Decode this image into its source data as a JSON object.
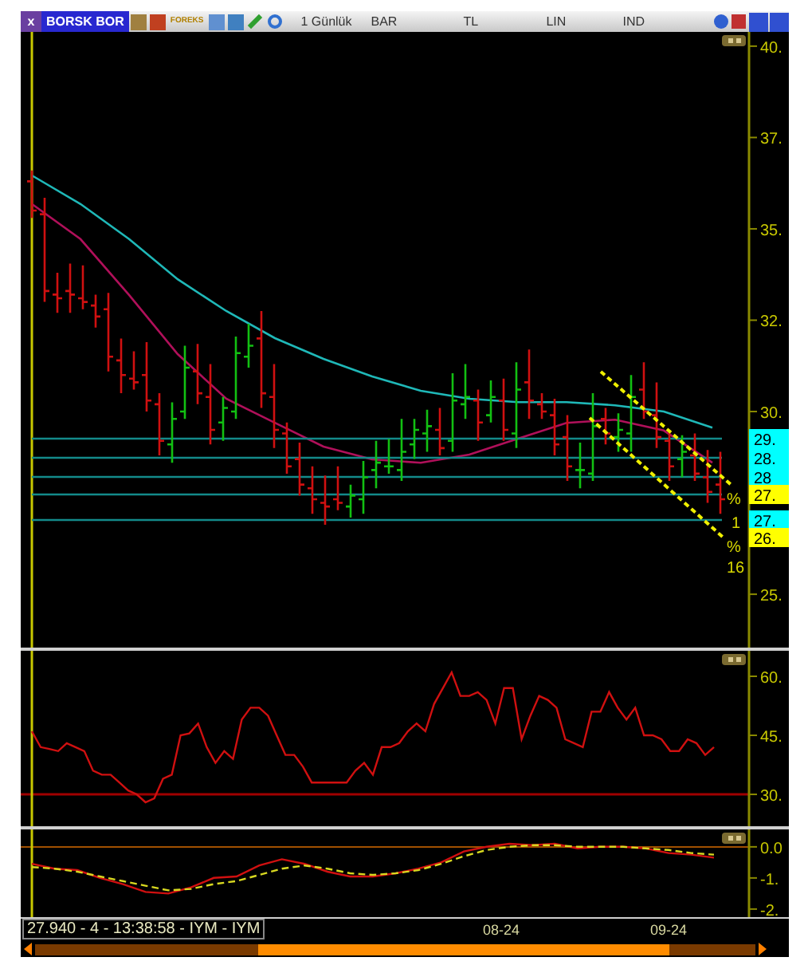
{
  "title_bar": {
    "close_glyph": "x",
    "symbol": "BORSK BOR",
    "logo_text": "FOREKS",
    "menus": [
      "1 Günlük",
      "BAR",
      "TL",
      "LIN",
      "IND"
    ]
  },
  "price_panel": {
    "chart_data": {
      "type": "line",
      "ylim": [
        23.54,
        40.39
      ],
      "yticks": [
        {
          "value": 40,
          "label": "40."
        },
        {
          "value": 37.5,
          "label": "37."
        },
        {
          "value": 35,
          "label": "35."
        },
        {
          "value": 32.5,
          "label": "32."
        },
        {
          "value": 30,
          "label": "30."
        },
        {
          "value": 25,
          "label": "25."
        }
      ],
      "series": [
        {
          "color": "#1fb8b8",
          "values": [
            36.46,
            35.68,
            34.72,
            33.62,
            32.75,
            32.01,
            31.44,
            30.96,
            30.57,
            30.35,
            30.26,
            30.26,
            30.17,
            30.0,
            29.56
          ]
        },
        {
          "color": "#b0105a",
          "values": [
            35.68,
            34.72,
            33.19,
            31.57,
            30.35,
            29.69,
            29.04,
            28.69,
            28.6,
            28.82,
            29.26,
            29.69,
            29.78,
            29.48,
            28.6
          ]
        }
      ]
    },
    "price_tags": [
      {
        "label": "29.",
        "color": "#00ffff"
      },
      {
        "label": "28.",
        "color": "#00ffff"
      },
      {
        "label": "28",
        "color": "#00ffff"
      },
      {
        "label": "27.",
        "color": "#ffff00"
      },
      {
        "label": "27.",
        "color": "#00ffff"
      },
      {
        "label": "26.",
        "color": "#ffff00"
      }
    ],
    "axis_notes": [
      "%",
      "1",
      "%",
      "16"
    ]
  },
  "rsi_panel": {
    "chart_data": {
      "type": "line",
      "ylim": [
        21.9,
        66.49
      ],
      "yticks": [
        {
          "value": 60,
          "label": "60."
        },
        {
          "value": 45,
          "label": "45."
        },
        {
          "value": 30,
          "label": "30."
        }
      ],
      "series": [
        {
          "color": "#d01010",
          "values": [
            46,
            42,
            41.5,
            41,
            43,
            42,
            41,
            36,
            35,
            35,
            33,
            31,
            30,
            28,
            29,
            34,
            35,
            45,
            45.5,
            48,
            42,
            38,
            41,
            39,
            49,
            52,
            52,
            50,
            45,
            40,
            40,
            37,
            33,
            33,
            33,
            33,
            33,
            36,
            38,
            35,
            42,
            42,
            43,
            46,
            48,
            46,
            53,
            57,
            61,
            55,
            55,
            56,
            54,
            48,
            57,
            57,
            44,
            50,
            55,
            54,
            52,
            44,
            43,
            42,
            51,
            51,
            56,
            52,
            49,
            52,
            45,
            45,
            44,
            41,
            41,
            44,
            43,
            40,
            42
          ]
        }
      ]
    }
  },
  "macd_panel": {
    "chart_data": {
      "type": "line",
      "ylim": [
        -2.26,
        0.56
      ],
      "yticks": [
        {
          "value": 0,
          "label": "0.0"
        },
        {
          "value": -1,
          "label": "-1."
        },
        {
          "value": -2,
          "label": "-2."
        }
      ],
      "series": [
        {
          "color": "#d01010",
          "line_style": "solid",
          "values": [
            -0.55,
            -0.7,
            -0.75,
            -1.0,
            -1.2,
            -1.45,
            -1.5,
            -1.3,
            -1.0,
            -0.95,
            -0.6,
            -0.4,
            -0.55,
            -0.8,
            -0.95,
            -0.95,
            -0.85,
            -0.7,
            -0.5,
            -0.15,
            0.0,
            0.1,
            0.05,
            0.1,
            -0.05,
            0.0,
            0.0,
            -0.05,
            -0.2,
            -0.25,
            -0.35
          ]
        },
        {
          "color": "#d8d820",
          "line_style": "dashed",
          "values": [
            -0.65,
            -0.7,
            -0.8,
            -0.95,
            -1.1,
            -1.25,
            -1.4,
            -1.35,
            -1.2,
            -1.1,
            -0.9,
            -0.7,
            -0.6,
            -0.7,
            -0.85,
            -0.9,
            -0.85,
            -0.75,
            -0.55,
            -0.3,
            -0.1,
            0.0,
            0.05,
            0.05,
            0.0,
            0.0,
            0.0,
            -0.05,
            -0.1,
            -0.2,
            -0.25
          ]
        }
      ]
    }
  },
  "status": "27.940 - 4 - 13:38:58 - IYM - IYM",
  "time_axis": {
    "labels": [
      "08-24",
      "09-24"
    ]
  }
}
